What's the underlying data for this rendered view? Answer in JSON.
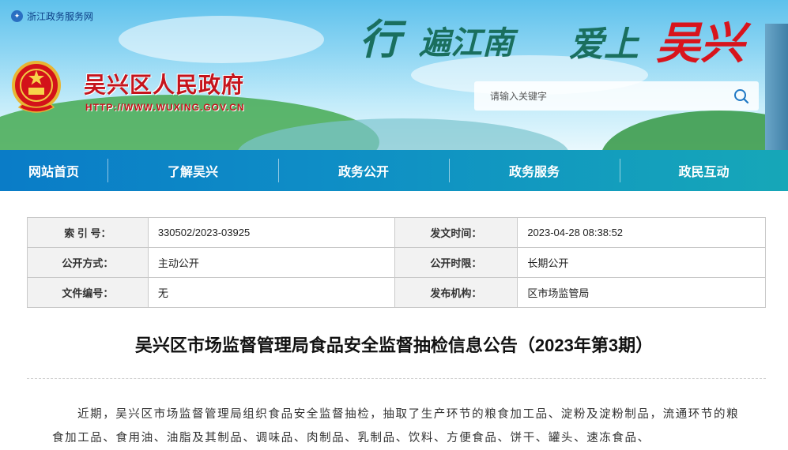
{
  "top_link": {
    "label": "浙江政务服务网",
    "icon": "zhejiang-service-icon"
  },
  "site": {
    "title": "吴兴区人民政府",
    "url": "HTTP://WWW.WUXING.GOV.CN",
    "emblem": "national-emblem-icon"
  },
  "slogan": {
    "part1": "行",
    "part2": "遍江南",
    "part3": "爱上",
    "part4": "吴兴"
  },
  "search": {
    "placeholder": "请输入关键字",
    "icon": "search-icon"
  },
  "nav": {
    "items": [
      {
        "label": "网站首页"
      },
      {
        "label": "了解吴兴"
      },
      {
        "label": "政务公开"
      },
      {
        "label": "政务服务"
      },
      {
        "label": "政民互动"
      }
    ]
  },
  "meta": {
    "index_label": "索 引 号：",
    "index_value": "330502/2023-03925",
    "date_label": "发文时间：",
    "date_value": "2023-04-28 08:38:52",
    "open_method_label": "公开方式：",
    "open_method_value": "主动公开",
    "open_period_label": "公开时限：",
    "open_period_value": "长期公开",
    "doc_no_label": "文件编号：",
    "doc_no_value": "无",
    "org_label": "发布机构：",
    "org_value": "区市场监管局"
  },
  "article": {
    "title": "吴兴区市场监督管理局食品安全监督抽检信息公告（2023年第3期）",
    "body": "近期，吴兴区市场监督管理局组织食品安全监督抽检，抽取了生产环节的粮食加工品、淀粉及淀粉制品，流通环节的粮食加工品、食用油、油脂及其制品、调味品、肉制品、乳制品、饮料、方便食品、饼干、罐头、速冻食品、"
  },
  "colors": {
    "brand_red": "#c5141c",
    "nav_blue": "#0a7cc7",
    "nav_teal": "#16a7b8"
  }
}
